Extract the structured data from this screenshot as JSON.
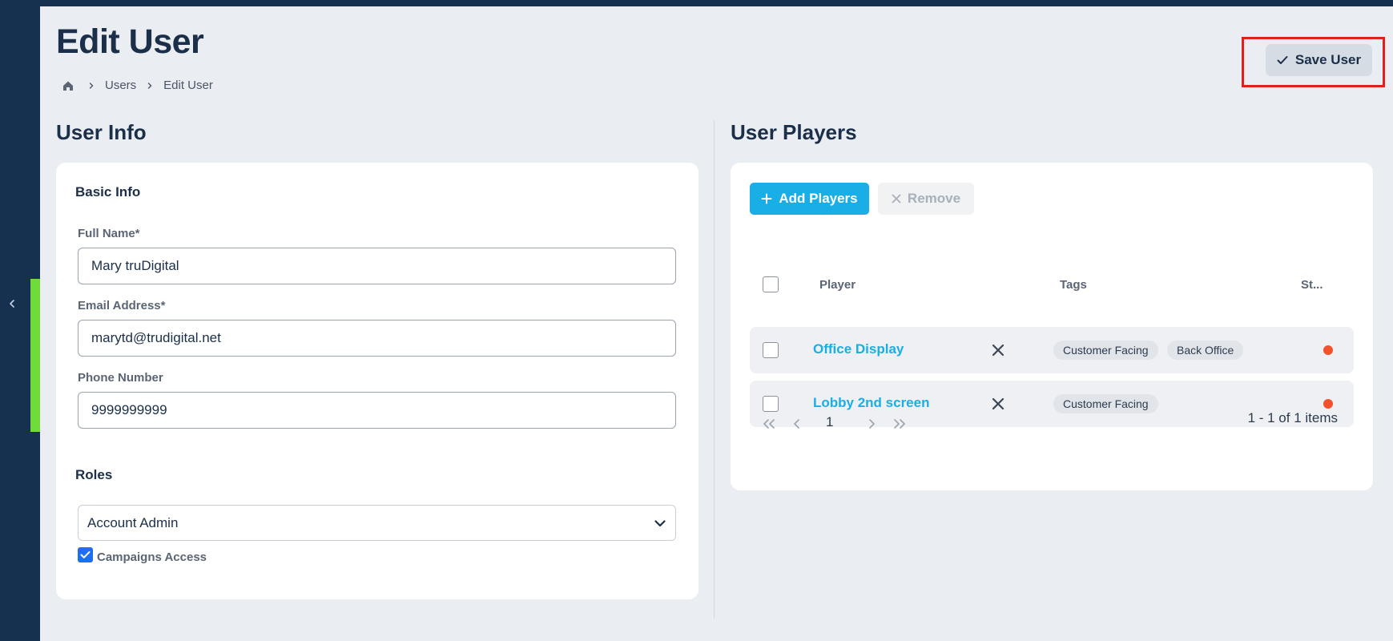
{
  "page": {
    "title": "Edit User",
    "breadcrumb": [
      "Users",
      "Edit User"
    ],
    "save_label": "Save User"
  },
  "user_info": {
    "section_title": "User Info",
    "basic_info_title": "Basic Info",
    "full_name_label": "Full Name*",
    "full_name_value": "Mary truDigital",
    "email_label": "Email Address*",
    "email_value": "marytd@trudigital.net",
    "phone_label": "Phone Number",
    "phone_value": "9999999999",
    "roles_title": "Roles",
    "role_selected": "Account Admin",
    "campaigns_access_label": "Campaigns Access",
    "campaigns_access_checked": true
  },
  "user_players": {
    "section_title": "User Players",
    "add_label": "Add Players",
    "remove_label": "Remove",
    "columns": [
      "Player",
      "Tags",
      "St..."
    ],
    "rows": [
      {
        "player": "Office Display",
        "tags": [
          "Customer Facing",
          "Back Office"
        ],
        "status": "offline"
      },
      {
        "player": "Lobby 2nd screen",
        "tags": [
          "Customer Facing"
        ],
        "status": "offline"
      }
    ],
    "page": "1",
    "pager_info": "1 - 1 of 1 items"
  },
  "colors": {
    "navy": "#163150",
    "accent_green": "#6fdc3c",
    "link_blue": "#1aaee6",
    "status_red": "#f1522c",
    "highlight_red": "#e31e1e"
  },
  "icons": [
    "chevron-left-icon",
    "home-icon",
    "chevron-right-icon",
    "check-icon",
    "plus-icon",
    "close-icon",
    "chevron-down-icon",
    "double-chevron-left-icon",
    "double-chevron-right-icon"
  ]
}
